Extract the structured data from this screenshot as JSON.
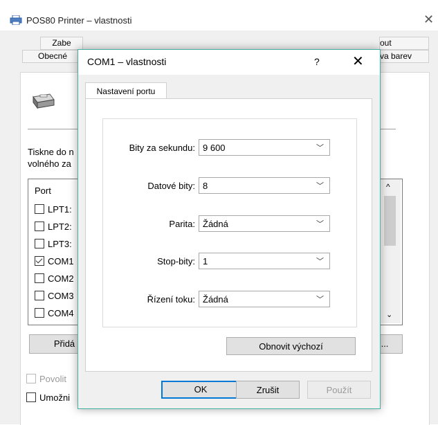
{
  "background_window": {
    "title": "POS80 Printer – vlastnosti",
    "tabs_row1": [
      "Zabe",
      "...",
      "...",
      "...out"
    ],
    "tabs_row2": [
      "Obecné",
      "...",
      "...",
      "va barev"
    ],
    "tab_top_right": "out",
    "tab_bottom_right": "va barev",
    "tab_top_left": "Zabe",
    "tab_bottom_left": "Obecné",
    "description_line1": "Tiskne do n",
    "description_line2": "volného za",
    "port_header": "Port",
    "ports": [
      {
        "label": "LPT1:",
        "checked": false
      },
      {
        "label": "LPT2:",
        "checked": false
      },
      {
        "label": "LPT3:",
        "checked": false
      },
      {
        "label": "COM1",
        "checked": true
      },
      {
        "label": "COM2",
        "checked": false
      },
      {
        "label": "COM3",
        "checked": false
      },
      {
        "label": "COM4",
        "checked": false
      }
    ],
    "add_button": "Přidá",
    "dots_button": "...",
    "enable_checkbox": "Povolit",
    "allow_checkbox": "Umožni"
  },
  "dialog": {
    "title": "COM1 – vlastnosti",
    "help": "?",
    "close": "✕",
    "tab": "Nastavení portu",
    "fields": [
      {
        "label": "Bity za sekundu:",
        "value": "9 600"
      },
      {
        "label": "Datové bity:",
        "value": "8"
      },
      {
        "label": "Parita:",
        "value": "Žádná"
      },
      {
        "label": "Stop-bity:",
        "value": "1"
      },
      {
        "label": "Řízení toku:",
        "value": "Žádná"
      }
    ],
    "restore_button": "Obnovit výchozí",
    "ok_button": "OK",
    "cancel_button": "Zrušit",
    "apply_button": "Použít"
  },
  "icons": {
    "printer": "printer-icon",
    "dropdown": "chevron-down-icon",
    "scroll_up": "chevron-up-icon",
    "scroll_down": "chevron-down-icon"
  }
}
